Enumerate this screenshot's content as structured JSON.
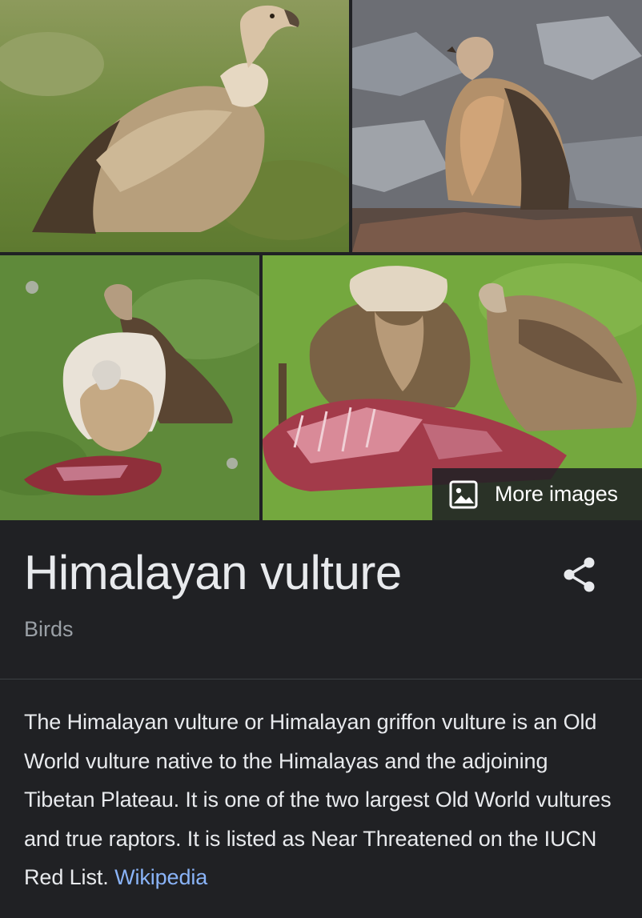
{
  "gallery": {
    "images": [
      {
        "alt": "Himalayan vulture standing on grass"
      },
      {
        "alt": "Himalayan vulture on rocks"
      },
      {
        "alt": "Himalayan vultures at carcass"
      },
      {
        "alt": "Himalayan vultures feeding on carcass"
      }
    ],
    "more_images_label": "More images"
  },
  "panel": {
    "title": "Himalayan vulture",
    "subtitle": "Birds",
    "description": "The Himalayan vulture or Himalayan griffon vulture is an Old World vulture native to the Himalayas and the adjoining Tibetan Plateau. It is one of the two largest Old World vultures and true raptors. It is listed as Near Threatened on the IUCN Red List.",
    "source_link": "Wikipedia"
  },
  "icons": {
    "more_images": "image-icon",
    "share": "share-icon"
  },
  "colors": {
    "background": "#202124",
    "text": "#e8eaed",
    "muted": "#9aa0a6",
    "link": "#8ab4f8"
  }
}
